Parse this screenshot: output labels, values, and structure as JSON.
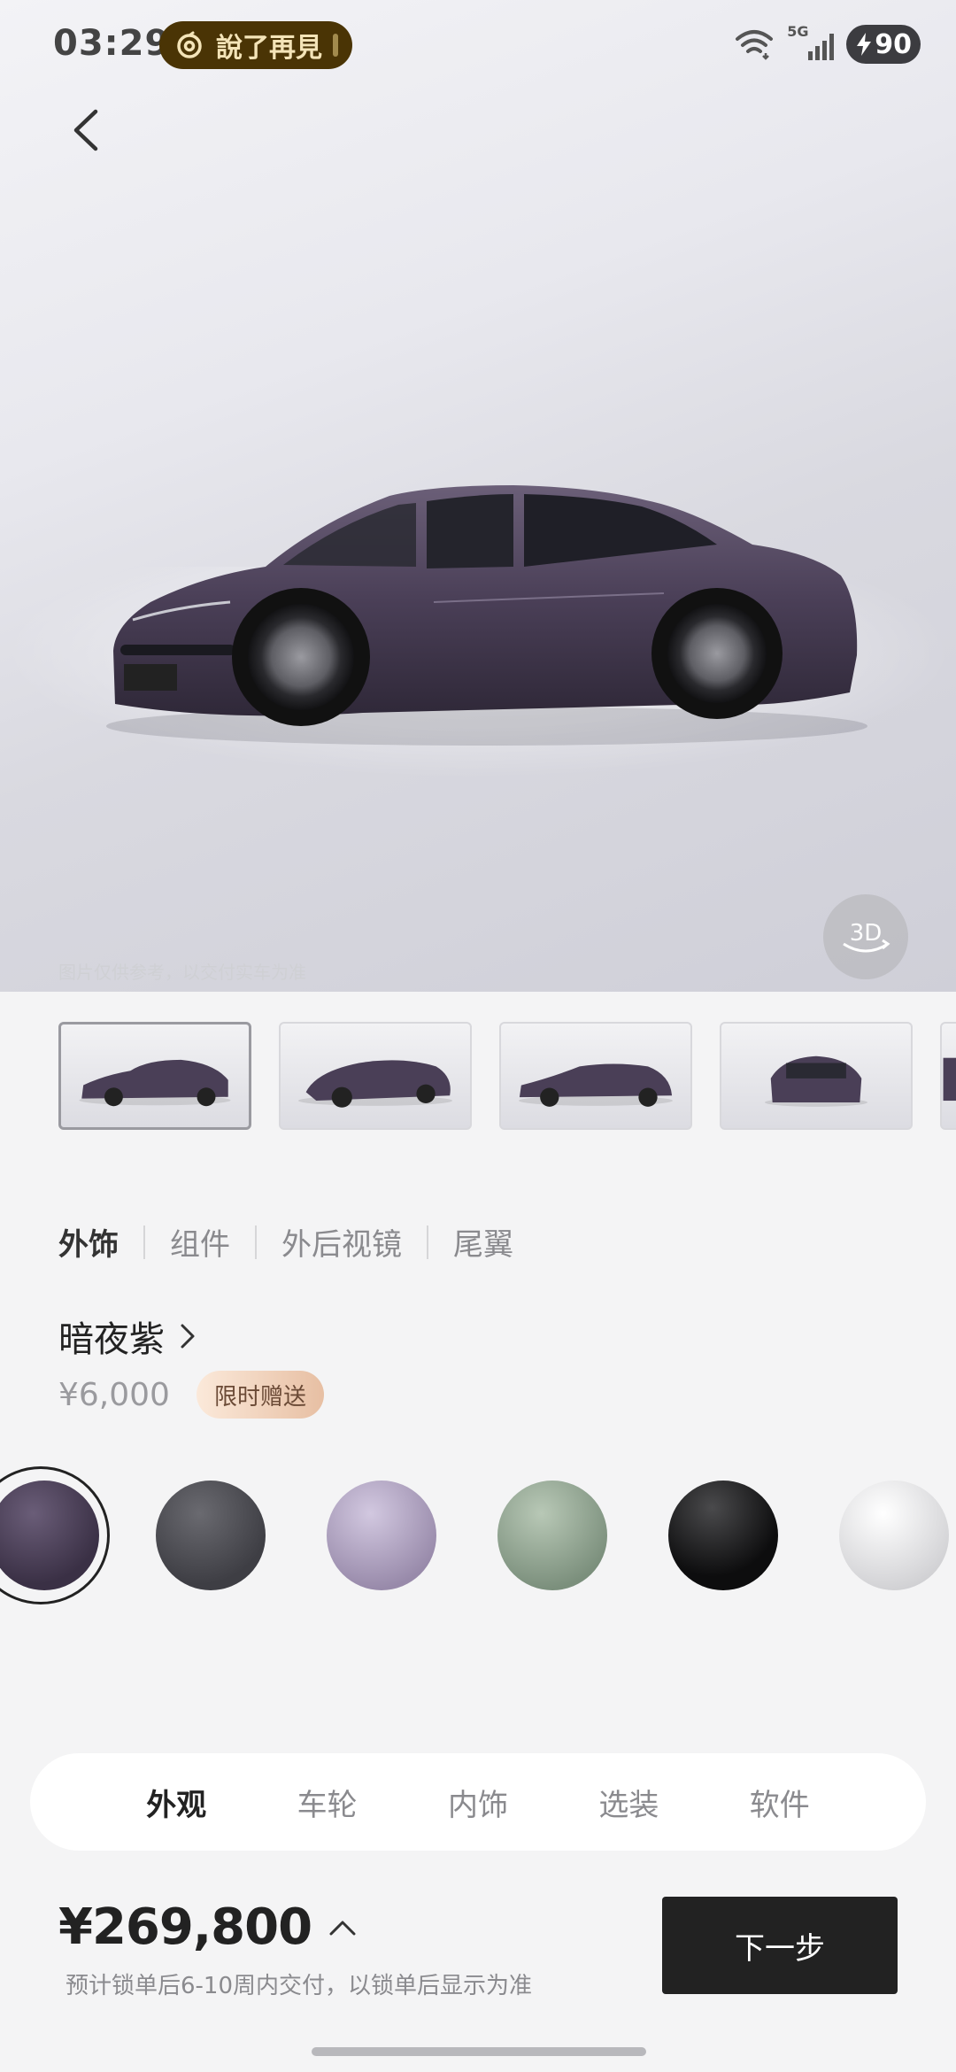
{
  "status_bar": {
    "time": "03:29",
    "music_title": "說了再見",
    "battery": "90",
    "network": "5G"
  },
  "hero": {
    "disclaimer": "图片仅供参考，以交付实车为准",
    "btn_3d_label": "3D"
  },
  "thumbnails": [
    {
      "name": "side-front-view"
    },
    {
      "name": "rear-three-quarter-view"
    },
    {
      "name": "side-view"
    },
    {
      "name": "front-view"
    },
    {
      "name": "partial-view"
    }
  ],
  "sub_tabs": [
    {
      "label": "外饰",
      "active": true
    },
    {
      "label": "组件",
      "active": false
    },
    {
      "label": "外后视镜",
      "active": false
    },
    {
      "label": "尾翼",
      "active": false
    }
  ],
  "selected_color": {
    "name": "暗夜紫",
    "price": "¥6,000",
    "badge": "限时赠送"
  },
  "swatches": [
    {
      "color": "#4a3e55",
      "selected": true
    },
    {
      "color": "#4f4f54",
      "selected": false
    },
    {
      "color": "#b3a8c6",
      "selected": false
    },
    {
      "color": "#9fb3a0",
      "selected": false
    },
    {
      "color": "#1a1a1a",
      "selected": false
    },
    {
      "color": "#e4e4e6",
      "selected": false
    }
  ],
  "category_nav": [
    {
      "label": "外观",
      "active": true
    },
    {
      "label": "车轮",
      "active": false
    },
    {
      "label": "内饰",
      "active": false
    },
    {
      "label": "选装",
      "active": false
    },
    {
      "label": "软件",
      "active": false
    }
  ],
  "footer": {
    "total_price": "¥269,800",
    "delivery_note": "预计锁单后6-10周内交付，以锁单后显示为准",
    "next_label": "下一步"
  }
}
